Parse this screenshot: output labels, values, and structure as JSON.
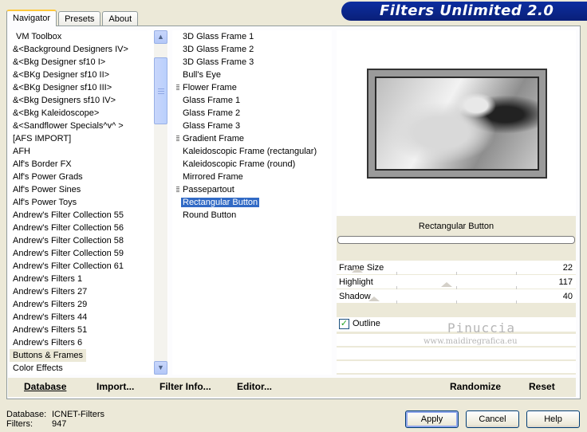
{
  "title": "Filters Unlimited 2.0",
  "tabs": [
    "Navigator",
    "Presets",
    "About"
  ],
  "categories": [
    "VM Toolbox",
    "&<Background Designers IV>",
    "&<Bkg Designer sf10 I>",
    "&<BKg Designer sf10 II>",
    "&<BKg Designer sf10 III>",
    "&<Bkg Designers sf10 IV>",
    "&<Bkg Kaleidoscope>",
    "&<Sandflower Specials^v^ >",
    "[AFS IMPORT]",
    "AFH",
    "Alf's Border FX",
    "Alf's Power Grads",
    "Alf's Power Sines",
    "Alf's Power Toys",
    "Andrew's Filter Collection 55",
    "Andrew's Filter Collection 56",
    "Andrew's Filter Collection 58",
    "Andrew's Filter Collection 59",
    "Andrew's Filter Collection 61",
    "Andrew's Filters 1",
    "Andrew's Filters 27",
    "Andrew's Filters 29",
    "Andrew's Filters 44",
    "Andrew's Filters 51",
    "Andrew's Filters 6",
    "Buttons & Frames",
    "Color Effects"
  ],
  "selected_category": "Buttons & Frames",
  "filters": [
    {
      "label": "3D Glass Frame 1",
      "marker": false
    },
    {
      "label": "3D Glass Frame 2",
      "marker": false
    },
    {
      "label": "3D Glass Frame 3",
      "marker": false
    },
    {
      "label": "Bull's Eye",
      "marker": false
    },
    {
      "label": "Flower Frame",
      "marker": true
    },
    {
      "label": "Glass Frame 1",
      "marker": false
    },
    {
      "label": "Glass Frame 2",
      "marker": false
    },
    {
      "label": "Glass Frame 3",
      "marker": false
    },
    {
      "label": "Gradient Frame",
      "marker": true
    },
    {
      "label": "Kaleidoscopic Frame (rectangular)",
      "marker": false
    },
    {
      "label": "Kaleidoscopic Frame (round)",
      "marker": false
    },
    {
      "label": "Mirrored Frame",
      "marker": false
    },
    {
      "label": "Passepartout",
      "marker": true
    },
    {
      "label": "Rectangular Button",
      "marker": false
    },
    {
      "label": "Round Button",
      "marker": false
    }
  ],
  "selected_filter": "Rectangular Button",
  "preview": {
    "filter_name": "Rectangular Button",
    "controls": [
      {
        "label": "Frame Size",
        "value": "22",
        "level": 22
      },
      {
        "label": "Highlight",
        "value": "117",
        "level": 117
      },
      {
        "label": "Shadow",
        "value": "40",
        "level": 40
      }
    ],
    "outline_label": "Outline",
    "outline_checked": true,
    "watermark_name": "Pinuccia",
    "watermark_url": "www.maidiregrafica.eu"
  },
  "buttons": {
    "database": "Database",
    "import": "Import...",
    "filter_info": "Filter Info...",
    "editor": "Editor...",
    "randomize": "Randomize",
    "reset": "Reset",
    "apply": "Apply",
    "cancel": "Cancel",
    "help": "Help"
  },
  "status": {
    "database_label": "Database:",
    "database_value": "ICNET-Filters",
    "filters_label": "Filters:",
    "filters_value": "947"
  },
  "colors": {
    "title_bar": "#0c2ea0",
    "selection": "#316ac5",
    "window_bg": "#ece9d8"
  }
}
